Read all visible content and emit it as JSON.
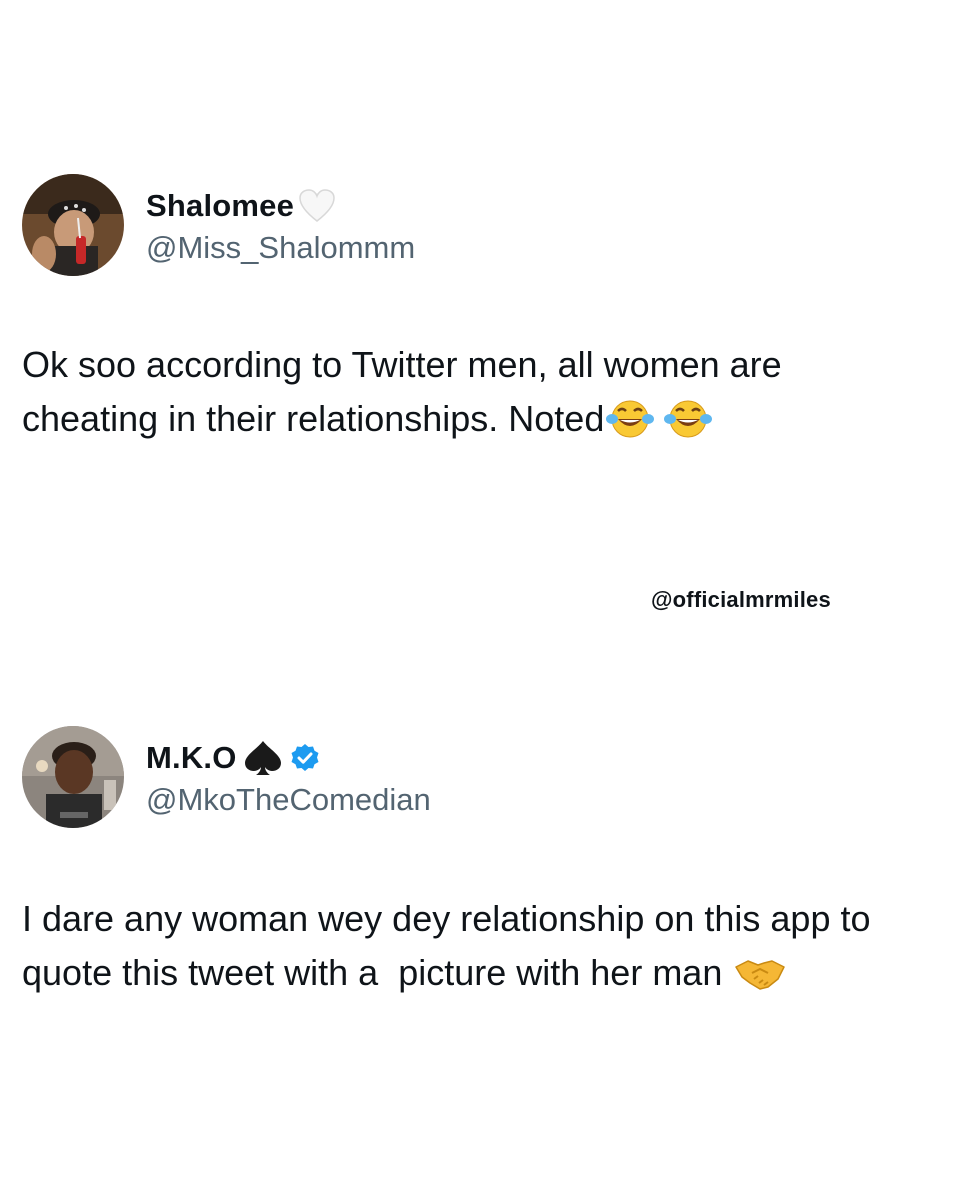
{
  "tweets": [
    {
      "display_name": "Shalomee",
      "handle": "@Miss_Shalommm",
      "name_badges": [
        "white-heart-icon"
      ],
      "text_main": "Ok soo according to Twitter men, all women are cheating in their relationships. Noted",
      "text_emojis": [
        "face-with-tears-of-joy-icon",
        "face-with-tears-of-joy-icon"
      ]
    },
    {
      "display_name": "M.K.O",
      "handle": "@MkoTheComedian",
      "name_badges": [
        "spade-icon",
        "verified-badge-icon"
      ],
      "text_main": "I dare any woman wey dey relationship on this app to quote this tweet with a  picture with her man",
      "text_emojis": [
        "handshake-icon"
      ]
    }
  ],
  "watermark": "@officialmrmiles",
  "colors": {
    "text": "#0f1419",
    "handle": "#536471",
    "verified": "#1d9bf0",
    "background": "#ffffff"
  }
}
